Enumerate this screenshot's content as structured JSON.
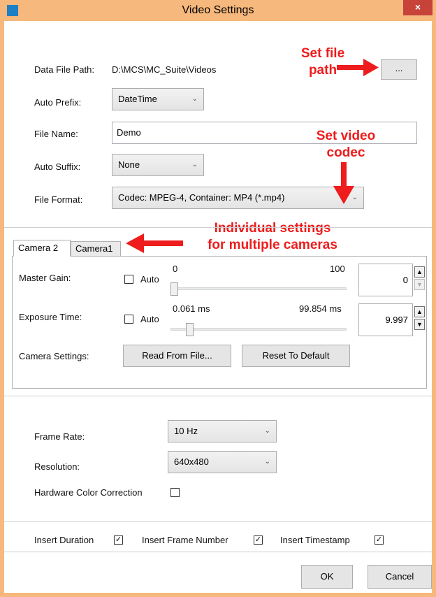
{
  "window": {
    "title": "Video Settings",
    "close_glyph": "×"
  },
  "file": {
    "data_file_path_label": "Data File Path:",
    "data_file_path_value": "D:\\MCS\\MC_Suite\\Videos",
    "browse_label": "...",
    "auto_prefix_label": "Auto Prefix:",
    "auto_prefix_value": "DateTime",
    "file_name_label": "File Name:",
    "file_name_value": "Demo",
    "auto_suffix_label": "Auto Suffix:",
    "auto_suffix_value": "None",
    "file_format_label": "File Format:",
    "file_format_value": "Codec: MPEG-4, Container: MP4 (*.mp4)"
  },
  "annotations": {
    "set_file_path_1": "Set file",
    "set_file_path_2": "path",
    "set_video_codec_1": "Set video",
    "set_video_codec_2": "codec",
    "individual_1": "Individual settings",
    "individual_2": "for multiple cameras"
  },
  "tabs": [
    {
      "label": "Camera 2",
      "active": true
    },
    {
      "label": "Camera1",
      "active": false
    }
  ],
  "camera": {
    "master_gain_label": "Master Gain:",
    "master_gain_auto_label": "Auto",
    "master_gain_min": "0",
    "master_gain_max": "100",
    "master_gain_value": "0",
    "exposure_time_label": "Exposure Time:",
    "exposure_auto_label": "Auto",
    "exposure_min": "0.061 ms",
    "exposure_max": "99.854 ms",
    "exposure_value": "9.997",
    "camera_settings_label": "Camera Settings:",
    "read_from_file_label": "Read From File...",
    "reset_to_default_label": "Reset To Default"
  },
  "video": {
    "frame_rate_label": "Frame Rate:",
    "frame_rate_value": "10 Hz",
    "resolution_label": "Resolution:",
    "resolution_value": "640x480",
    "hw_color_correction_label": "Hardware Color Correction"
  },
  "overlay": {
    "insert_duration_label": "Insert Duration",
    "insert_frame_number_label": "Insert Frame Number",
    "insert_timestamp_label": "Insert Timestamp"
  },
  "footer": {
    "ok_label": "OK",
    "cancel_label": "Cancel"
  },
  "icons": {
    "check": "✓",
    "chevron": "⌄",
    "up": "▲",
    "down": "▼"
  },
  "colors": {
    "frame": "#f6b87c",
    "close": "#c7433a",
    "annotation": "#ee1c1c"
  }
}
